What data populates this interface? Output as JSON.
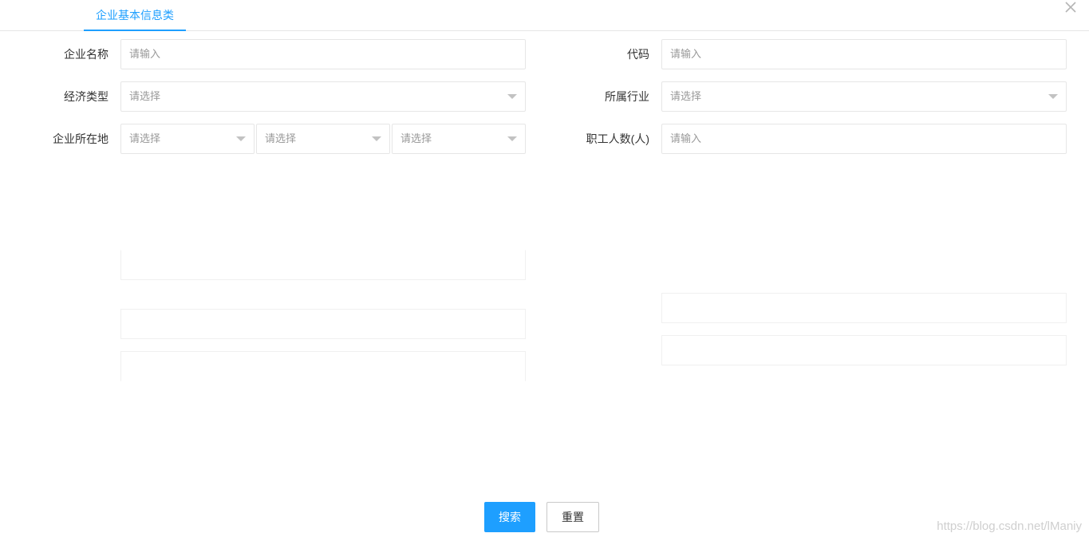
{
  "tabs": [
    {
      "label": "企业基本信息类"
    }
  ],
  "form": {
    "company_name": {
      "label": "企业名称",
      "placeholder": "请输入"
    },
    "code": {
      "label": "代码",
      "placeholder": "请输入"
    },
    "economic_type": {
      "label": "经济类型",
      "placeholder": "请选择"
    },
    "industry": {
      "label": "所属行业",
      "placeholder": "请选择"
    },
    "location": {
      "label": "企业所在地",
      "selects": [
        "请选择",
        "请选择",
        "请选择"
      ]
    },
    "employees": {
      "label": "职工人数(人)",
      "placeholder": "请输入"
    }
  },
  "buttons": {
    "search": "搜索",
    "reset": "重置"
  },
  "watermark": "https://blog.csdn.net/lManiy",
  "colors": {
    "accent": "#1e9fff",
    "border": "#e6e6e6"
  }
}
